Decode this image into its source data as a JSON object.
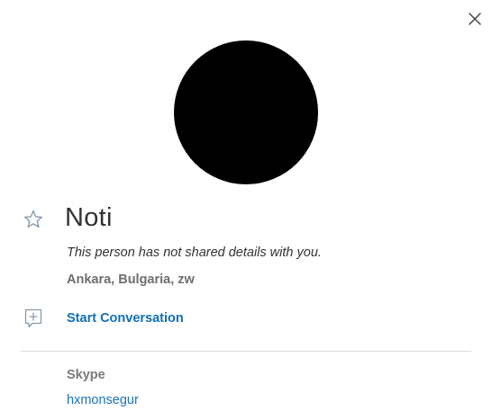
{
  "header": {
    "close_icon": "close-icon"
  },
  "profile": {
    "avatar_color": "#000000",
    "name": "Noti",
    "favorite_icon": "star-outline-icon",
    "status": "This person has not shared details with you.",
    "location": "Ankara, Bulgaria, zw"
  },
  "actions": {
    "start_conversation_icon": "add-conversation-icon",
    "start_conversation_label": "Start Conversation"
  },
  "details": {
    "skype_label": "Skype",
    "skype_id": "hxmonsegur"
  },
  "colors": {
    "link": "#0f6fb5",
    "muted": "#7a7a7a",
    "text": "#333333",
    "icon": "#8a9bab",
    "divider": "#dcdcdc"
  }
}
